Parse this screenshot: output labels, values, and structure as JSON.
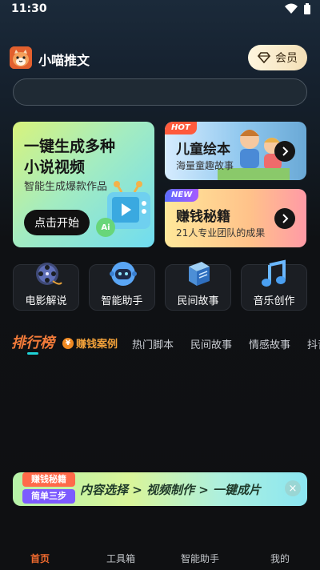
{
  "status": {
    "time": "11:30"
  },
  "header": {
    "title": "小喵推文",
    "vip_label": "会员"
  },
  "search": {
    "placeholder": ""
  },
  "main_card": {
    "title_line1": "一键生成多种",
    "title_line2": "小说视频",
    "subtitle": "智能生成爆款作品",
    "button": "点击开始",
    "ai_badge": "Ai"
  },
  "kids_card": {
    "badge": "HOT",
    "title": "儿童绘本",
    "subtitle": "海量童趣故事"
  },
  "money_card": {
    "badge": "NEW",
    "title": "赚钱秘籍",
    "subtitle": "21人专业团队的成果"
  },
  "tools": [
    {
      "label": "电影解说",
      "icon": "film-reel-icon"
    },
    {
      "label": "智能助手",
      "icon": "robot-icon"
    },
    {
      "label": "民间故事",
      "icon": "book-icon"
    },
    {
      "label": "音乐创作",
      "icon": "music-note-icon"
    }
  ],
  "tabs": {
    "active": "排行榜",
    "money": "赚钱案例",
    "items": [
      "热门脚本",
      "民间故事",
      "情感故事",
      "抖音"
    ]
  },
  "promo": {
    "tag_line1": "赚钱秘籍",
    "tag_line2": "简单三步",
    "text": "内容选择 > 视频制作 > 一键成片"
  },
  "nav": {
    "items": [
      "首页",
      "工具箱",
      "智能助手",
      "我的"
    ]
  },
  "colors": {
    "accent": "#f06a2e",
    "tab_underline": "#1fd3d8",
    "vip_bg": "#f3dfb6"
  }
}
